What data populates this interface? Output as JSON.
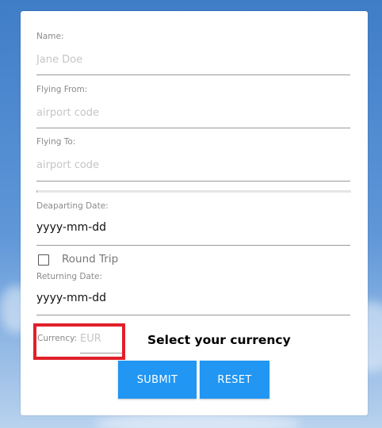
{
  "form": {
    "name": {
      "label": "Name:",
      "placeholder": "Jane Doe"
    },
    "from": {
      "label": "Flying From:",
      "placeholder": "airport code"
    },
    "to": {
      "label": "Flying To:",
      "placeholder": "airport code"
    },
    "departing": {
      "label": "Deaparting Date:",
      "value": "yyyy-mm-dd"
    },
    "round_trip": {
      "label": "Round Trip",
      "checked": false
    },
    "returning": {
      "label": "Returning Date:",
      "value": "yyyy-mm-dd"
    },
    "currency": {
      "label": "Currency:",
      "placeholder": "EUR"
    }
  },
  "annotation": {
    "text": "Select your currency",
    "color": "#e0202a"
  },
  "buttons": {
    "submit": "SUBMIT",
    "reset": "RESET"
  },
  "colors": {
    "accent": "#2196f3",
    "background": "#4a86cf"
  }
}
